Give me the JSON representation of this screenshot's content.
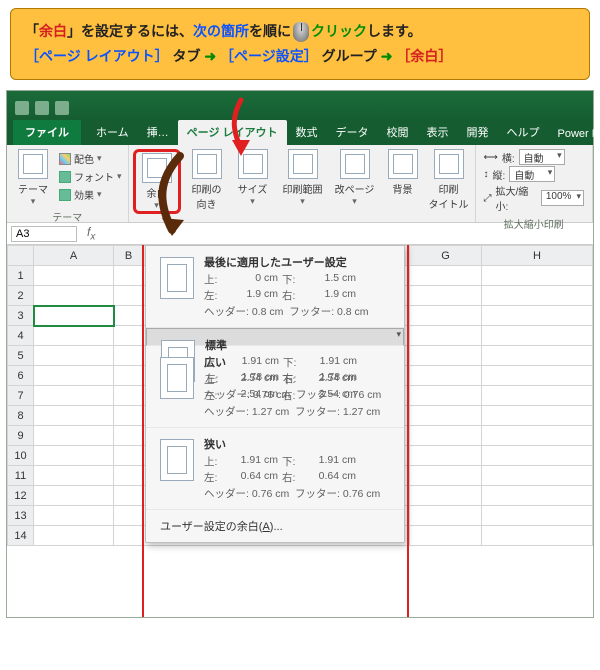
{
  "callout": {
    "line1_prefix": "「",
    "line1_yohaku": "余白",
    "line1_mid": "」を設定するには、",
    "line1_next": "次の箇所",
    "line1_after": "を順に",
    "line1_click": "クリック",
    "line1_end": "します。",
    "line2_tab_brk": "［ページ レイアウト］",
    "line2_tab_word": "タブ",
    "line2_grp_brk": "［ページ設定］",
    "line2_grp_word": "グループ",
    "line2_yohaku_brk": "［余白］"
  },
  "tabs": {
    "file": "ファイル",
    "home": "ホーム",
    "insert": "挿…",
    "pagelayout": "ページ レイアウト",
    "formulas": "数式",
    "data": "データ",
    "review": "校閲",
    "view": "表示",
    "developer": "開発",
    "help": "ヘルプ",
    "powerpivot": "Power Pivot"
  },
  "themeGroup": {
    "colors": "配色",
    "fonts": "フォント",
    "effects": "効果",
    "themes": "テーマ",
    "label": "テーマ"
  },
  "pageSetup": {
    "margins": "余白",
    "orientation": "印刷の\n向き",
    "size": "サイズ",
    "printArea": "印刷範囲",
    "breaks": "改ページ",
    "background": "背景",
    "printTitles": "印刷\nタイトル"
  },
  "scale": {
    "widthLabel": "横:",
    "heightLabel": "縦:",
    "widthVal": "自動",
    "heightVal": "自動",
    "scaleLabel": "拡大/縮小:",
    "scaleVal": "100%",
    "groupLabel": "拡大縮小印刷"
  },
  "namebox": "A3",
  "cols": [
    "A",
    "B",
    "G",
    "H"
  ],
  "marginOptions": {
    "last": {
      "title": "最後に適用したユーザー設定",
      "top": "0 cm",
      "bottom": "1.5 cm",
      "left": "1.9 cm",
      "right": "1.9 cm",
      "header": "0.8 cm",
      "footer": "0.8 cm"
    },
    "normal": {
      "title": "標準",
      "top": "1.91 cm",
      "bottom": "1.91 cm",
      "left": "1.78 cm",
      "right": "1.78 cm",
      "header": "0.76 cm",
      "footer": "0.76 cm"
    },
    "wide": {
      "title": "広い",
      "top": "2.54 cm",
      "bottom": "2.54 cm",
      "left": "2.54 cm",
      "right": "2.54 cm",
      "header": "1.27 cm",
      "footer": "1.27 cm"
    },
    "narrow": {
      "title": "狭い",
      "top": "1.91 cm",
      "bottom": "1.91 cm",
      "left": "0.64 cm",
      "right": "0.64 cm",
      "header": "0.76 cm",
      "footer": "0.76 cm"
    },
    "labels": {
      "top": "上:",
      "bottom": "下:",
      "left": "左:",
      "right": "右:",
      "header": "ヘッダー:",
      "footer": "フッター:"
    },
    "custom": "ユーザー設定の余白(",
    "customKey": "A",
    "customEnd": ")..."
  }
}
